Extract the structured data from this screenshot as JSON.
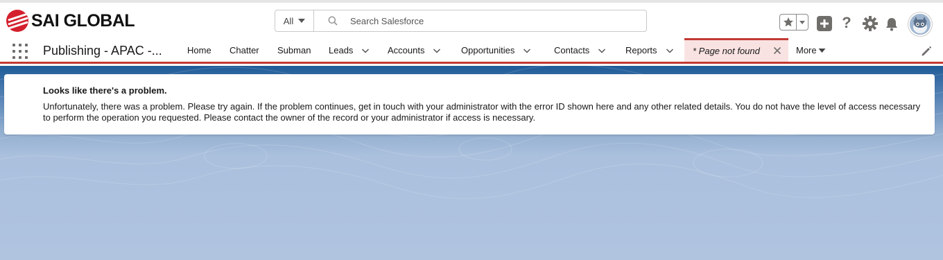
{
  "header": {
    "logo_text": "SAI GLOBAL",
    "search": {
      "scope": "All",
      "placeholder": "Search Salesforce"
    },
    "icons": [
      "favorites-star-icon",
      "add-icon",
      "help-icon",
      "setup-gear-icon",
      "notifications-bell-icon",
      "avatar"
    ]
  },
  "nav": {
    "app_name": "Publishing - APAC -...",
    "items": [
      {
        "label": "Home",
        "has_menu": false
      },
      {
        "label": "Chatter",
        "has_menu": false
      },
      {
        "label": "Subman",
        "has_menu": false
      },
      {
        "label": "Leads",
        "has_menu": true
      },
      {
        "label": "Accounts",
        "has_menu": true
      },
      {
        "label": "Opportunities",
        "has_menu": true
      },
      {
        "label": "Contacts",
        "has_menu": true
      },
      {
        "label": "Reports",
        "has_menu": true
      }
    ],
    "active_tab": {
      "label": "* Page not found"
    },
    "more_label": "More"
  },
  "error": {
    "title": "Looks like there's a problem.",
    "message": "Unfortunately, there was a problem. Please try again. If the problem continues, get in touch with your administrator with the error ID shown here and any other related details. You do not have the level of access necessary to perform the operation you requested. Please contact the owner of the record or your administrator if access is necessary."
  },
  "colors": {
    "brand_red": "#c23934",
    "logo_red": "#d4202d",
    "active_tab_bg": "#f9e3e2",
    "background_blue": "#1f5b98"
  }
}
